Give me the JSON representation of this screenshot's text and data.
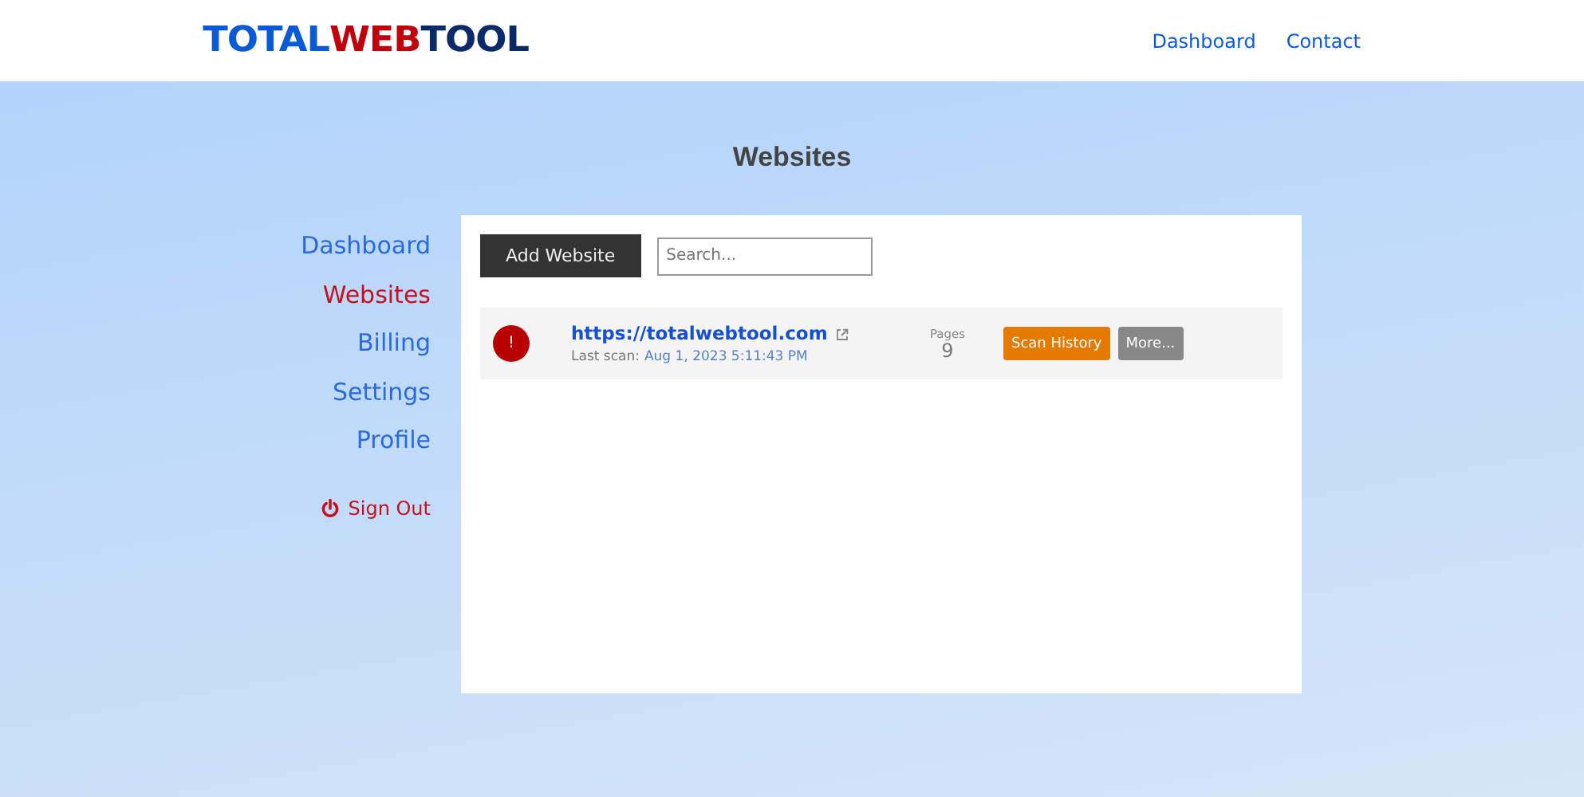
{
  "logo": [
    {
      "text": "TOTAL",
      "color": "#0a5ad8"
    },
    {
      "text": "WEB",
      "color": "#c0000a"
    },
    {
      "text": "TOOL",
      "color": "#0a2a6a"
    }
  ],
  "nav": [
    {
      "label": "Dashboard"
    },
    {
      "label": "Contact"
    }
  ],
  "page_title": "Websites",
  "sidebar": {
    "items": [
      {
        "label": "Dashboard",
        "selected": false
      },
      {
        "label": "Websites",
        "selected": true
      },
      {
        "label": "Billing",
        "selected": false
      },
      {
        "label": "Settings",
        "selected": false
      },
      {
        "label": "Profile",
        "selected": false
      }
    ],
    "sign_out": "Sign Out"
  },
  "toolbar": {
    "add_button": "Add Website",
    "search": {
      "placeholder": "Search..."
    }
  },
  "websites": [
    {
      "error": true,
      "status_mark": "!",
      "url": "https://totalwebtool.com",
      "last_scan_label": "Last scan:",
      "last_scan": "Aug 1, 2023 5:11:43 PM",
      "pages_label": "Pages",
      "pages": "9",
      "buttons": [
        "Scan History",
        "More..."
      ]
    }
  ]
}
